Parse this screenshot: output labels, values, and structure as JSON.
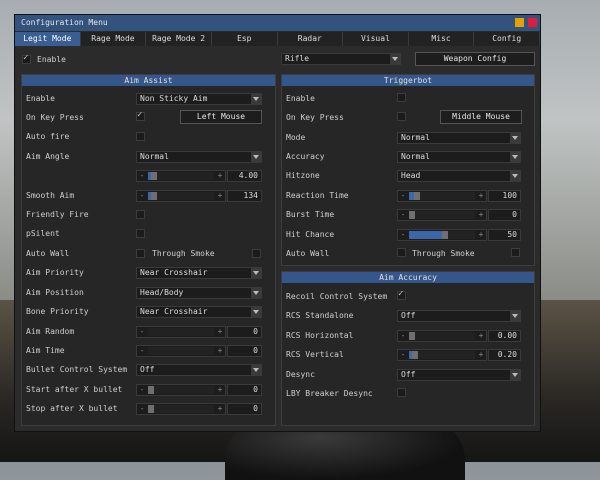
{
  "window": {
    "title": "Configuration Menu"
  },
  "tabs": [
    "Legit Mode",
    "Rage Mode",
    "Rage Mode 2",
    "Esp",
    "Radar",
    "Visual",
    "Misc",
    "Config"
  ],
  "top": {
    "enable_label": "Enable",
    "weapon": "Rifle",
    "weapon_config_label": "Weapon Config"
  },
  "aim_assist": {
    "header": "Aim Assist",
    "enable": {
      "label": "Enable",
      "value": "Non Sticky Aim"
    },
    "on_key_press": {
      "label": "On Key Press",
      "key": "Left Mouse"
    },
    "auto_fire": {
      "label": "Auto fire"
    },
    "aim_angle": {
      "label": "Aim Angle",
      "value": "Normal",
      "slider_value": "4.00",
      "fraction": 0.05
    },
    "smooth_aim": {
      "label": "Smooth Aim",
      "value": "134",
      "fraction": 0.04
    },
    "friendly_fire": {
      "label": "Friendly Fire"
    },
    "psilent": {
      "label": "pSilent"
    },
    "auto_wall": {
      "label": "Auto Wall",
      "through_smoke": "Through Smoke"
    },
    "aim_priority": {
      "label": "Aim Priority",
      "value": "Near Crosshair"
    },
    "aim_position": {
      "label": "Aim Position",
      "value": "Head/Body"
    },
    "bone_priority": {
      "label": "Bone Priority",
      "value": "Near Crosshair"
    },
    "aim_random": {
      "label": "Aim Random",
      "value": "0"
    },
    "aim_time": {
      "label": "Aim Time",
      "value": "0"
    },
    "bullet_control": {
      "label": "Bullet Control System",
      "value": "Off"
    },
    "start_after": {
      "label": "Start after X bullet",
      "value": "0"
    },
    "stop_after": {
      "label": "Stop after X bullet",
      "value": "0"
    }
  },
  "triggerbot": {
    "header": "Triggerbot",
    "enable": {
      "label": "Enable"
    },
    "on_key_press": {
      "label": "On Key Press",
      "key": "Middle Mouse"
    },
    "mode": {
      "label": "Mode",
      "value": "Normal"
    },
    "accuracy": {
      "label": "Accuracy",
      "value": "Normal"
    },
    "hitzone": {
      "label": "Hitzone",
      "value": "Head"
    },
    "reaction_time": {
      "label": "Reaction Time",
      "value": "100",
      "fraction": 0.08
    },
    "burst_time": {
      "label": "Burst Time",
      "value": "0",
      "fraction": 0.0
    },
    "hit_chance": {
      "label": "Hit Chance",
      "value": "50",
      "fraction": 0.5
    },
    "auto_wall": {
      "label": "Auto Wall",
      "through_smoke": "Through Smoke"
    }
  },
  "aim_accuracy": {
    "header": "Aim Accuracy",
    "rcs": {
      "label": "Recoil Control System"
    },
    "rcs_standalone": {
      "label": "RCS Standalone",
      "value": "Off"
    },
    "rcs_horizontal": {
      "label": "RCS Horizontal",
      "value": "0.00",
      "fraction": 0.0
    },
    "rcs_vertical": {
      "label": "RCS Vertical",
      "value": "0.20",
      "fraction": 0.05
    },
    "desync": {
      "label": "Desync",
      "value": "Off"
    },
    "lby_breaker": {
      "label": "LBY Breaker Desync"
    }
  },
  "colors": {
    "accent": "#3b5e92",
    "minimize": "#e5a100",
    "close": "#e01e3a"
  }
}
